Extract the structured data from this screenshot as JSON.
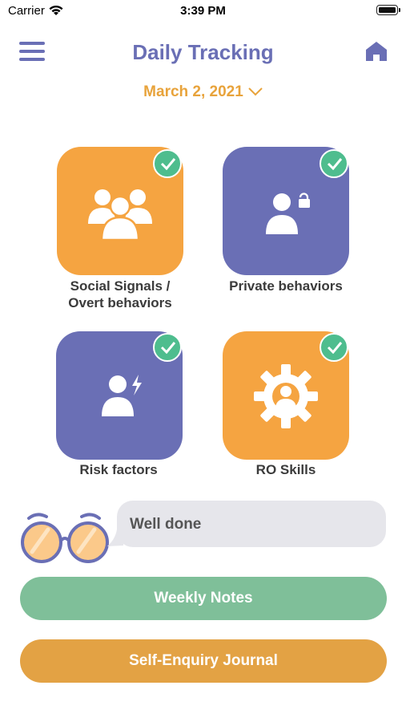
{
  "status_bar": {
    "carrier": "Carrier",
    "time": "3:39 PM"
  },
  "header": {
    "title": "Daily Tracking",
    "menu_icon": "hamburger-menu-icon",
    "home_icon": "home-icon"
  },
  "date": {
    "label": "March 2, 2021"
  },
  "tiles": [
    {
      "label_line1": "Social Signals /",
      "label_line2": "Overt behaviors",
      "color": "#f5a441",
      "icon": "group-icon",
      "completed": true
    },
    {
      "label": "Private behaviors",
      "color": "#6a6fb5",
      "icon": "person-lock-icon",
      "completed": true
    },
    {
      "label": "Risk factors",
      "color": "#6a6fb5",
      "icon": "person-bolt-icon",
      "completed": true
    },
    {
      "label": "RO Skills",
      "color": "#f5a441",
      "icon": "gear-person-icon",
      "completed": true
    }
  ],
  "feedback": {
    "message": "Well done",
    "mascot": "glasses-icon"
  },
  "buttons": {
    "weekly_notes": "Weekly Notes",
    "journal": "Self-Enquiry Journal"
  },
  "colors": {
    "accent": "#6a6fb5",
    "orange": "#f5a441",
    "green": "#7fbf99",
    "gold": "#e3a244",
    "check": "#4ebd8e"
  }
}
